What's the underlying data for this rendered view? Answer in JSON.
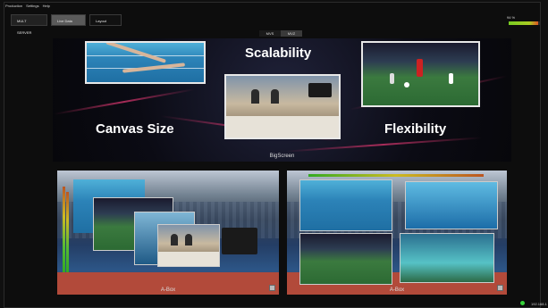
{
  "menu": {
    "items": [
      "Production",
      "Settings",
      "Help"
    ]
  },
  "toolbar": {
    "buttons": [
      "MULT SERVER",
      "Live Data",
      "Layout"
    ]
  },
  "meter": {
    "percent_label": "94 %",
    "level": 0.94
  },
  "modes": {
    "items": [
      "MVS",
      "MVZ"
    ],
    "active_index": 0
  },
  "bigscreen": {
    "caption": "BigScreen",
    "texts": {
      "scalability": "Scalability",
      "canvas_size": "Canvas Size",
      "flexibility": "Flexibility"
    }
  },
  "aboxes": {
    "left_label": "A-Box",
    "right_label": "A-Box"
  },
  "status": {
    "text": "192.168.1"
  },
  "colors": {
    "accent_green": "#36d33a",
    "glow_pink": "#d0346a"
  }
}
